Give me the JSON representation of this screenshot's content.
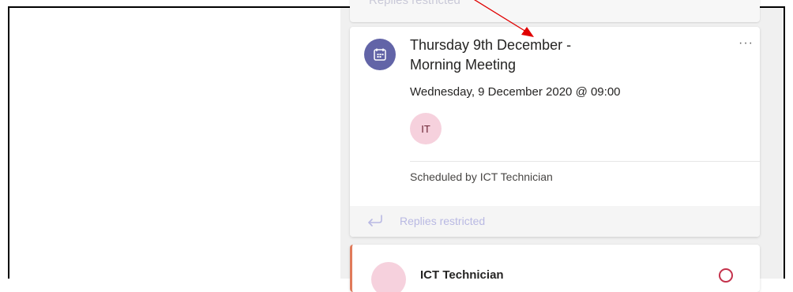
{
  "post": {
    "title": "Thursday 9th December -\nMorning Meeting",
    "date": "Wednesday, 9 December 2020 @ 09:00",
    "attendee_initials": "IT",
    "scheduled_by": "Scheduled by ICT Technician",
    "replies_label": "Replies restricted",
    "more_label": "···"
  },
  "prev_post": {
    "replies_label_partial": "Replies restricted"
  },
  "next_post": {
    "author_name": "ICT Technician"
  },
  "colors": {
    "calendar_avatar": "#6264a7",
    "initials_avatar": "#f6d1dd",
    "replies_text": "#b9b9e3",
    "annotation_arrow": "#e00000",
    "post_accent": "#e07a5a"
  },
  "icons": {
    "calendar": "calendar-icon",
    "reply": "reply-icon",
    "more": "more-options-icon",
    "alert": "alert-icon"
  }
}
